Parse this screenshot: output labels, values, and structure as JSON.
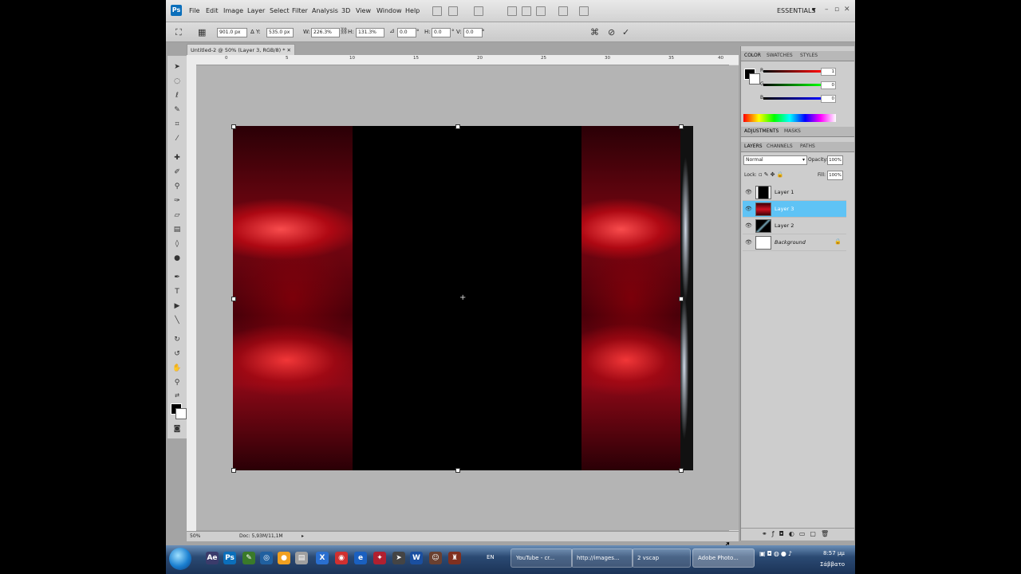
{
  "app": {
    "logo": "Ps"
  },
  "menu": [
    "File",
    "Edit",
    "Image",
    "Layer",
    "Select",
    "Filter",
    "Analysis",
    "3D",
    "View",
    "Window",
    "Help"
  ],
  "workspace": "ESSENTIALS",
  "window_controls": [
    "–",
    "▫",
    "✕"
  ],
  "options": {
    "x_value": "901.0 px",
    "y_label": "Y:",
    "y_value": "535.0 px",
    "w_label": "W:",
    "w_value": "226.3%",
    "h_label": "H:",
    "h_value": "131.3%",
    "angle_value": "0.0",
    "hskew_label": "H:",
    "hskew_value": "0.0",
    "vskew_label": "V:",
    "vskew_value": "0.0"
  },
  "document": {
    "tab_title": "Untitled-2 @ 50% (Layer 3, RGB/8) *",
    "ruler_labels": [
      "0",
      "5",
      "10",
      "15",
      "20",
      "25",
      "30",
      "35",
      "40"
    ],
    "zoom": "50%",
    "doc_size": "Doc: 5,93M/11,1M"
  },
  "color_panel": {
    "tabs": [
      "COLOR",
      "SWATCHES",
      "STYLES"
    ],
    "channels": [
      {
        "label": "R",
        "value": "1"
      },
      {
        "label": "G",
        "value": "0"
      },
      {
        "label": "B",
        "value": "0"
      }
    ]
  },
  "adjust_panel": {
    "tabs": [
      "ADJUSTMENTS",
      "MASKS"
    ]
  },
  "layers_panel": {
    "tabs": [
      "LAYERS",
      "CHANNELS",
      "PATHS"
    ],
    "blend_mode": "Normal",
    "opacity_label": "Opacity:",
    "opacity": "100%",
    "lock_label": "Lock:",
    "fill_label": "Fill:",
    "fill": "100%",
    "layers": [
      "Layer 1",
      "Layer 3",
      "Layer 2",
      "Background"
    ]
  },
  "taskbar": {
    "lang": "EN",
    "buttons": [
      "YouTube - cr...",
      "http://images...",
      "2 vscap",
      "Adobe Photo..."
    ],
    "time": "8:57 μμ",
    "day": "Σάββατο"
  },
  "colors": {
    "accent_selection": "#5fc3f5",
    "canvas_red": "#d01020"
  }
}
